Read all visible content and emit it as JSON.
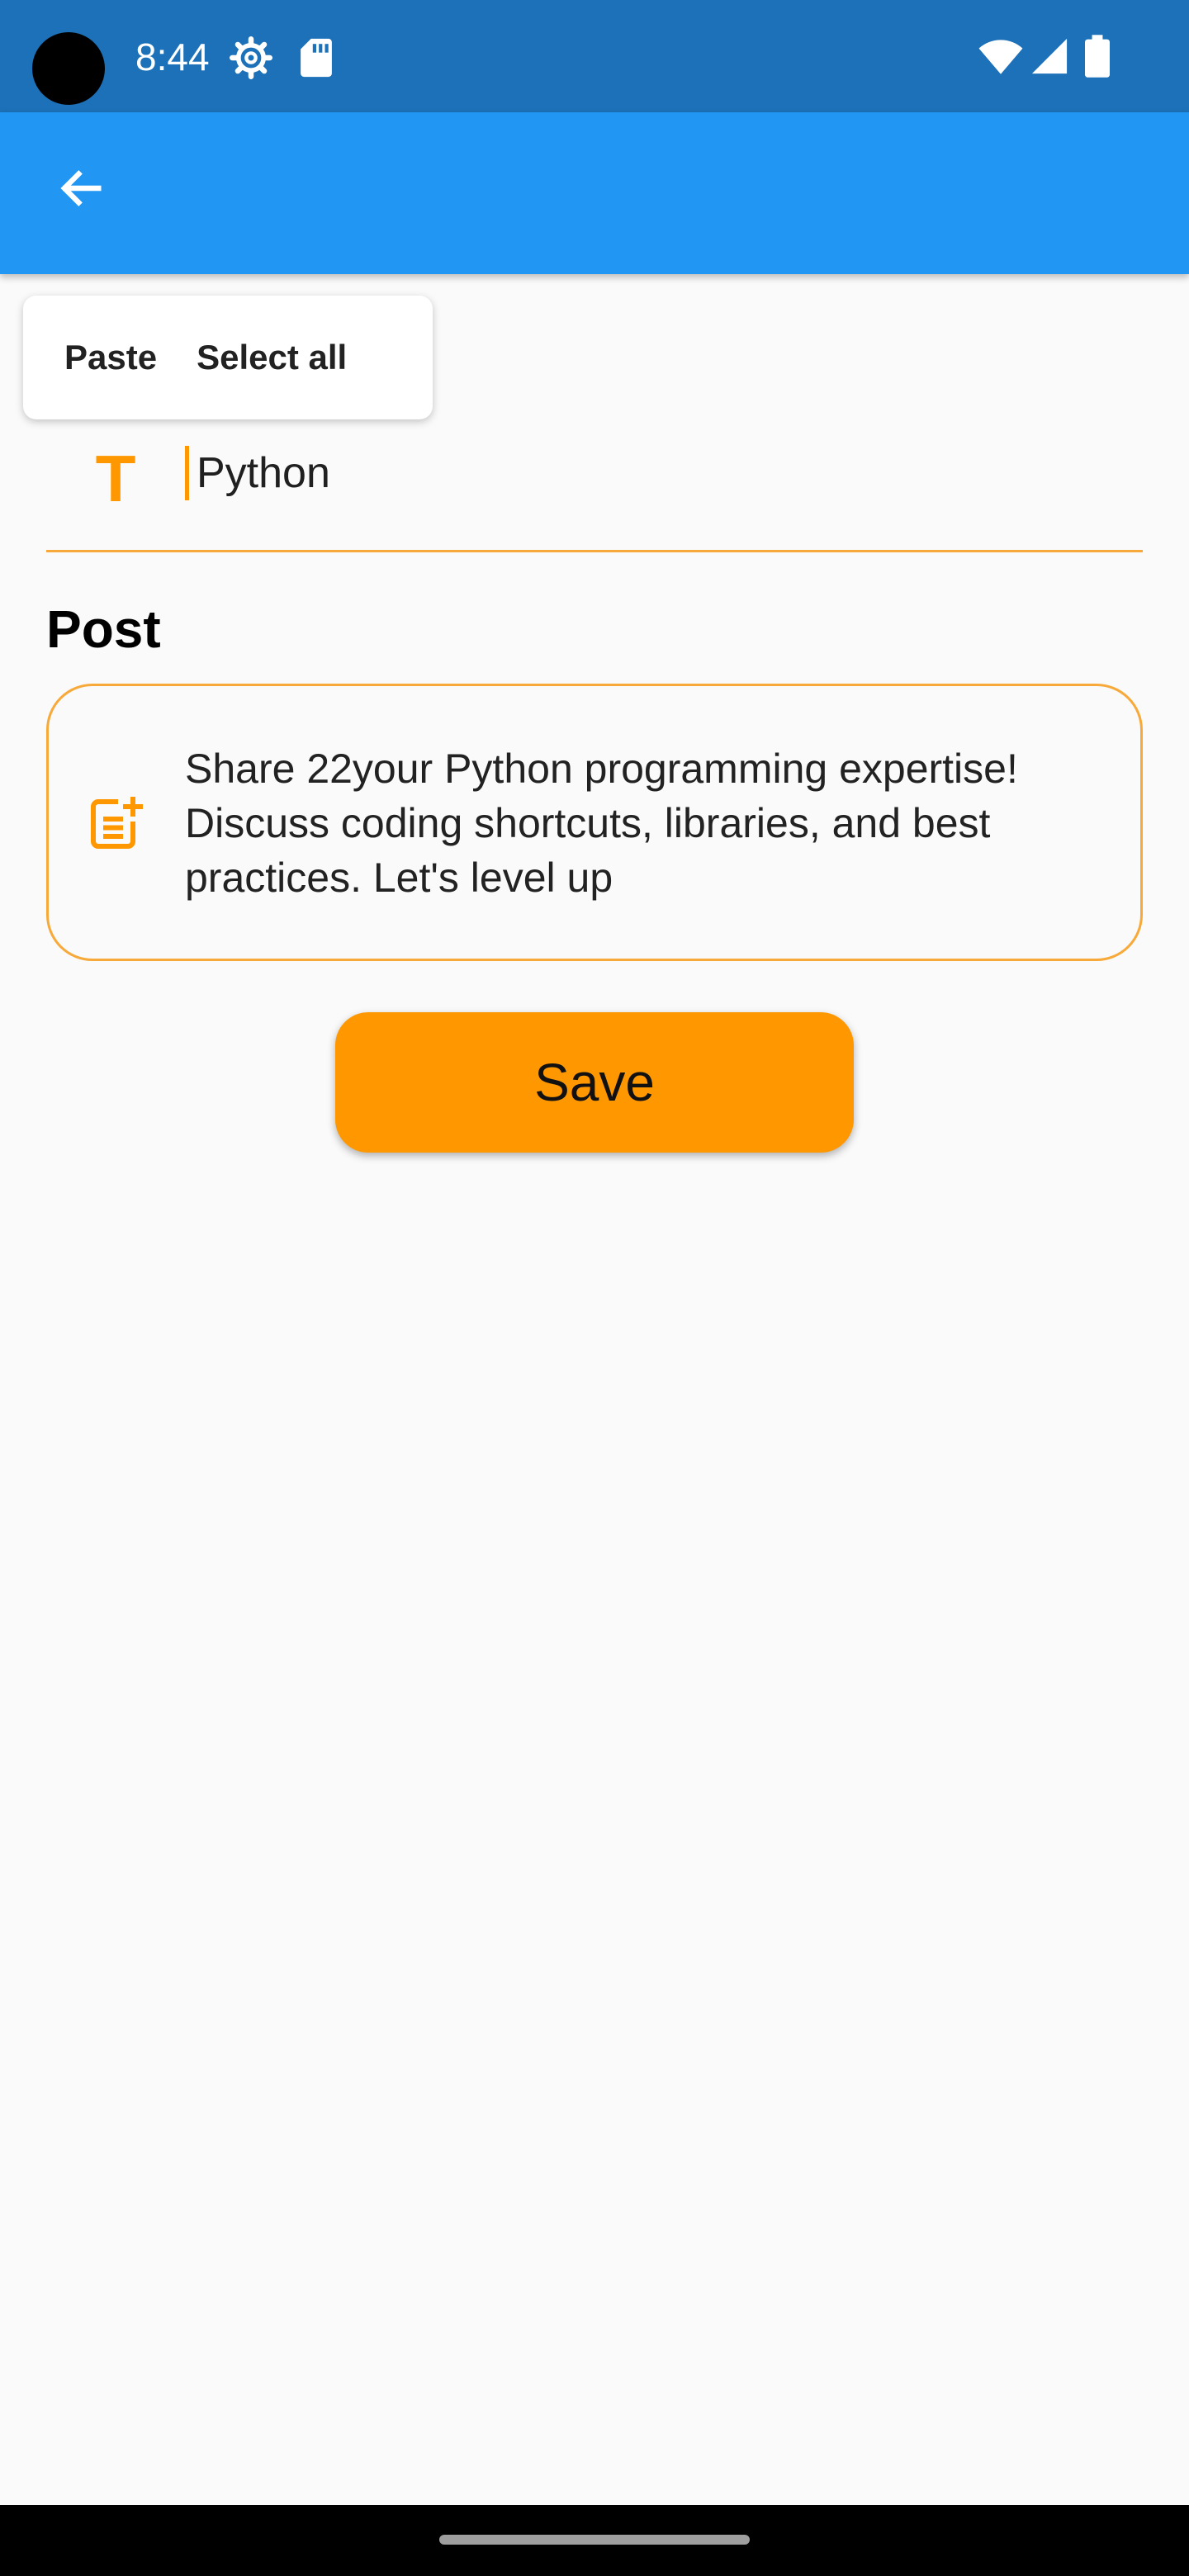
{
  "status_bar": {
    "time": "8:44",
    "icons": [
      "gear-icon",
      "sd-card-icon",
      "wifi-icon",
      "signal-icon",
      "battery-icon"
    ]
  },
  "app_bar": {
    "back_icon": "arrow-left-icon"
  },
  "context_menu": {
    "items": [
      {
        "label": "Paste"
      },
      {
        "label": "Select all"
      }
    ]
  },
  "form": {
    "title_icon_glyph": "T",
    "title_value": "Python",
    "post_label": "Post",
    "post_icon": "post-add-icon",
    "post_value": "Share 22your Python programming expertise! Discuss coding shortcuts, libraries, and best practices. Let's level up",
    "save_label": "Save"
  },
  "colors": {
    "status_bar": "#1C71B8",
    "app_bar": "#2196F3",
    "accent": "#FF9800",
    "background": "#FAFAFA"
  }
}
